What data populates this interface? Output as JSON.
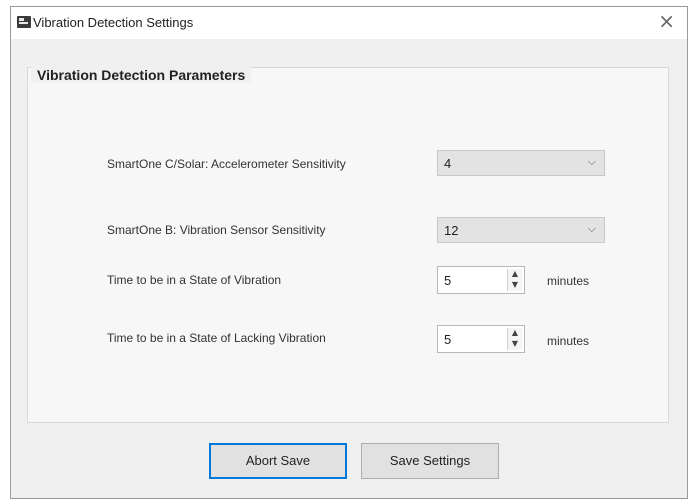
{
  "window": {
    "title": "Vibration Detection Settings",
    "close_glyph": "×"
  },
  "group": {
    "title": "Vibration Detection Parameters"
  },
  "fields": {
    "accelerometer": {
      "label": "SmartOne C/Solar: Accelerometer Sensitivity",
      "value": "4"
    },
    "vibration_sensor": {
      "label": "SmartOne B: Vibration Sensor Sensitivity",
      "value": "12"
    },
    "state_vibration": {
      "label": "Time to be in a State of Vibration",
      "value": "5",
      "unit": "minutes"
    },
    "state_lacking": {
      "label": "Time to be in a State of Lacking Vibration",
      "value": "5",
      "unit": "minutes"
    }
  },
  "buttons": {
    "abort_label": "Abort Save",
    "save_label": "Save Settings"
  },
  "glyphs": {
    "chevron": "⌵",
    "spin_up": "▲",
    "spin_down": "▼"
  },
  "colors": {
    "focus_accent": "#0078d7"
  }
}
